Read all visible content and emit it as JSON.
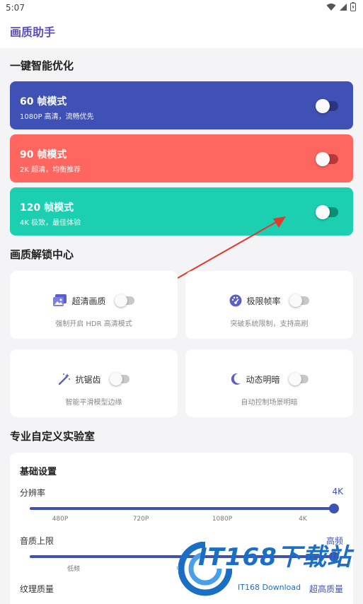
{
  "status_bar": {
    "time": "5:07"
  },
  "app": {
    "title": "画质助手"
  },
  "sections": {
    "smart": "一键智能优化",
    "unlock": "画质解锁中心",
    "lab": "专业自定义实验室"
  },
  "modes": [
    {
      "title": "60 帧模式",
      "subtitle": "1080P 高清，流畅优先",
      "color": "#3f51b5",
      "enabled": false
    },
    {
      "title": "90 帧模式",
      "subtitle": "2K 超清，均衡推荐",
      "color": "#ff6660",
      "enabled": false
    },
    {
      "title": "120 帧模式",
      "subtitle": "4K 极致，最佳体验",
      "color": "#1ccfb0",
      "enabled": false
    }
  ],
  "unlock_items": [
    {
      "label": "超清画质",
      "desc": "强制开启 HDR 高清模式",
      "icon": "photo-icon"
    },
    {
      "label": "极限帧率",
      "desc": "突破系统限制，支持高刷",
      "icon": "speed-gauge-icon"
    },
    {
      "label": "抗锯齿",
      "desc": "智能平滑模型边缘",
      "icon": "magic-wand-icon"
    },
    {
      "label": "动态明暗",
      "desc": "自动控制场景明暗",
      "icon": "moon-icon"
    }
  ],
  "lab": {
    "basic_title": "基础设置",
    "resolution": {
      "label": "分辨率",
      "value": "4K",
      "ticks": [
        "480P",
        "720P",
        "1080P",
        "4K"
      ],
      "level": 1.0
    },
    "audio": {
      "label": "音质上限",
      "value": "高频",
      "ticks": [
        "低频",
        "中"
      ],
      "level": 1.0
    },
    "texture": {
      "label": "纹理质量",
      "value": "超高质量"
    }
  },
  "watermark": {
    "brand": "IT168下载站",
    "sub": "IT168 Download"
  }
}
